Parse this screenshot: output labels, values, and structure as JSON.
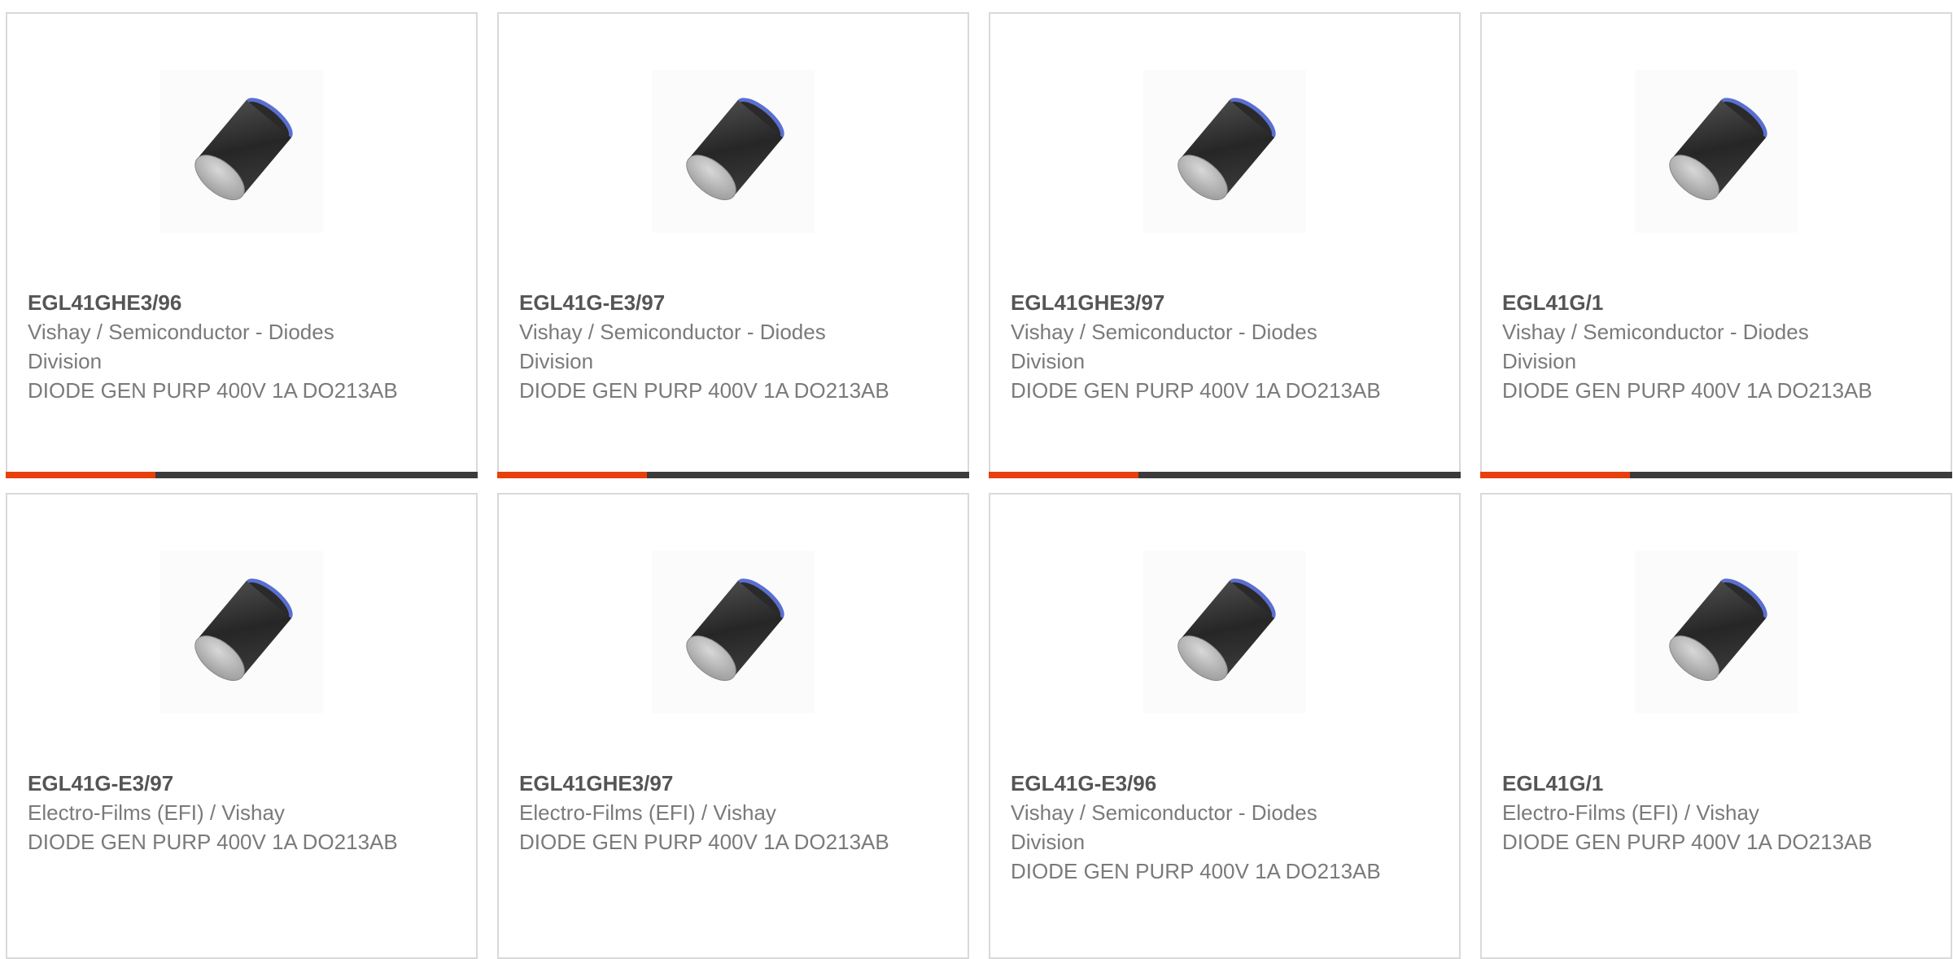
{
  "colors": {
    "accent": "#e8400c",
    "bar_dark": "#3b3b3b",
    "border": "#d9d9d9",
    "part_number": "#555555",
    "body_text": "#7a7a7a"
  },
  "products": [
    {
      "part_number": "EGL41GHE3/96",
      "manufacturer": "Vishay / Semiconductor - Diodes Division",
      "description": "DIODE GEN PURP 400V 1A DO213AB",
      "image": "diode-melf-icon"
    },
    {
      "part_number": "EGL41G-E3/97",
      "manufacturer": "Vishay / Semiconductor - Diodes Division",
      "description": "DIODE GEN PURP 400V 1A DO213AB",
      "image": "diode-melf-icon"
    },
    {
      "part_number": "EGL41GHE3/97",
      "manufacturer": "Vishay / Semiconductor - Diodes Division",
      "description": "DIODE GEN PURP 400V 1A DO213AB",
      "image": "diode-melf-icon"
    },
    {
      "part_number": "EGL41G/1",
      "manufacturer": "Vishay / Semiconductor - Diodes Division",
      "description": "DIODE GEN PURP 400V 1A DO213AB",
      "image": "diode-melf-icon"
    },
    {
      "part_number": "EGL41G-E3/97",
      "manufacturer": "Electro-Films (EFI) / Vishay",
      "description": "DIODE GEN PURP 400V 1A DO213AB",
      "image": "diode-melf-icon"
    },
    {
      "part_number": "EGL41GHE3/97",
      "manufacturer": "Electro-Films (EFI) / Vishay",
      "description": "DIODE GEN PURP 400V 1A DO213AB",
      "image": "diode-melf-icon"
    },
    {
      "part_number": "EGL41G-E3/96",
      "manufacturer": "Vishay / Semiconductor - Diodes Division",
      "description": "DIODE GEN PURP 400V 1A DO213AB",
      "image": "diode-melf-icon"
    },
    {
      "part_number": "EGL41G/1",
      "manufacturer": "Electro-Films (EFI) / Vishay",
      "description": "DIODE GEN PURP 400V 1A DO213AB",
      "image": "diode-melf-icon"
    }
  ]
}
